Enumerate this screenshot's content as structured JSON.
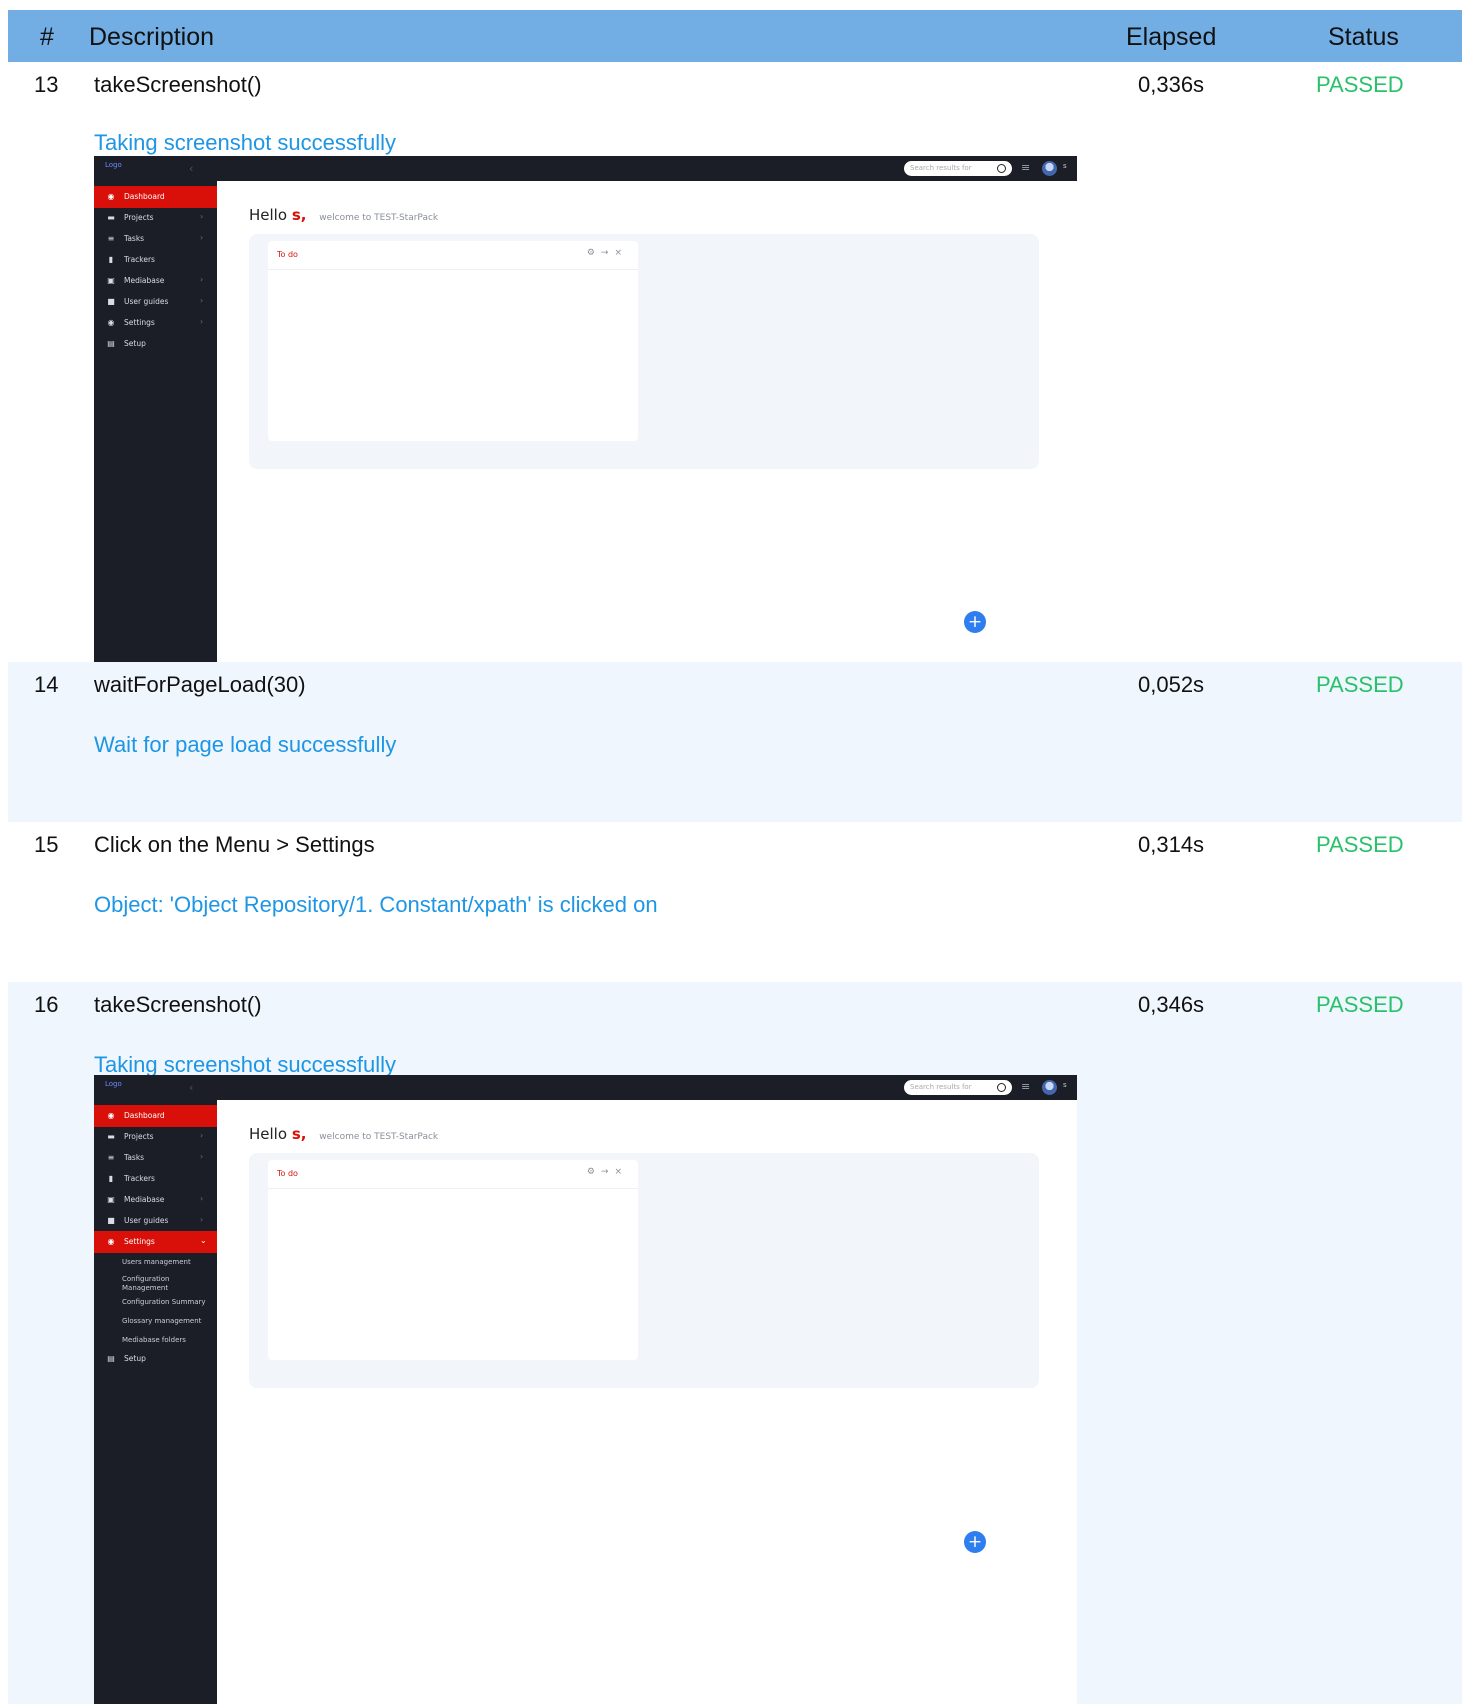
{
  "table": {
    "headers": {
      "num": "#",
      "description": "Description",
      "elapsed": "Elapsed",
      "status": "Status"
    }
  },
  "steps": [
    {
      "num": "13",
      "description": "takeScreenshot()",
      "elapsed": "0,336s",
      "status": "PASSED",
      "message": "Taking screenshot successfully"
    },
    {
      "num": "14",
      "description": "waitForPageLoad(30)",
      "elapsed": "0,052s",
      "status": "PASSED",
      "message": "Wait for page load successfully"
    },
    {
      "num": "15",
      "description": "Click on the Menu > Settings",
      "elapsed": "0,314s",
      "status": "PASSED",
      "message": "Object: 'Object Repository/1. Constant/xpath' is clicked on"
    },
    {
      "num": "16",
      "description": "takeScreenshot()",
      "elapsed": "0,346s",
      "status": "PASSED",
      "message": "Taking screenshot successfully"
    }
  ],
  "app": {
    "logo_text": "Logo",
    "search_placeholder": "Search results for",
    "user_initial": "s",
    "nav": [
      "Dashboard",
      "Projects",
      "Tasks",
      "Trackers",
      "Mediabase",
      "User guides",
      "Settings",
      "Setup"
    ],
    "settings_submenu": [
      "Users management",
      "Configuration Management",
      "Configuration Summary",
      "Glossary management",
      "Mediabase folders"
    ],
    "greeting_hello": "Hello",
    "greeting_user": "s,",
    "greeting_welcome": "welcome to TEST-StarPack",
    "card_title": "To do",
    "collapse_icon": "chevron-left-icon",
    "fab_icon": "plus-icon"
  },
  "colors": {
    "header_bg": "#72ade3",
    "passed": "#2ac16b",
    "message": "#1e96e4",
    "alt_row": "#eff6fd",
    "app_dark": "#1b1e27",
    "app_accent": "#d9100a"
  }
}
